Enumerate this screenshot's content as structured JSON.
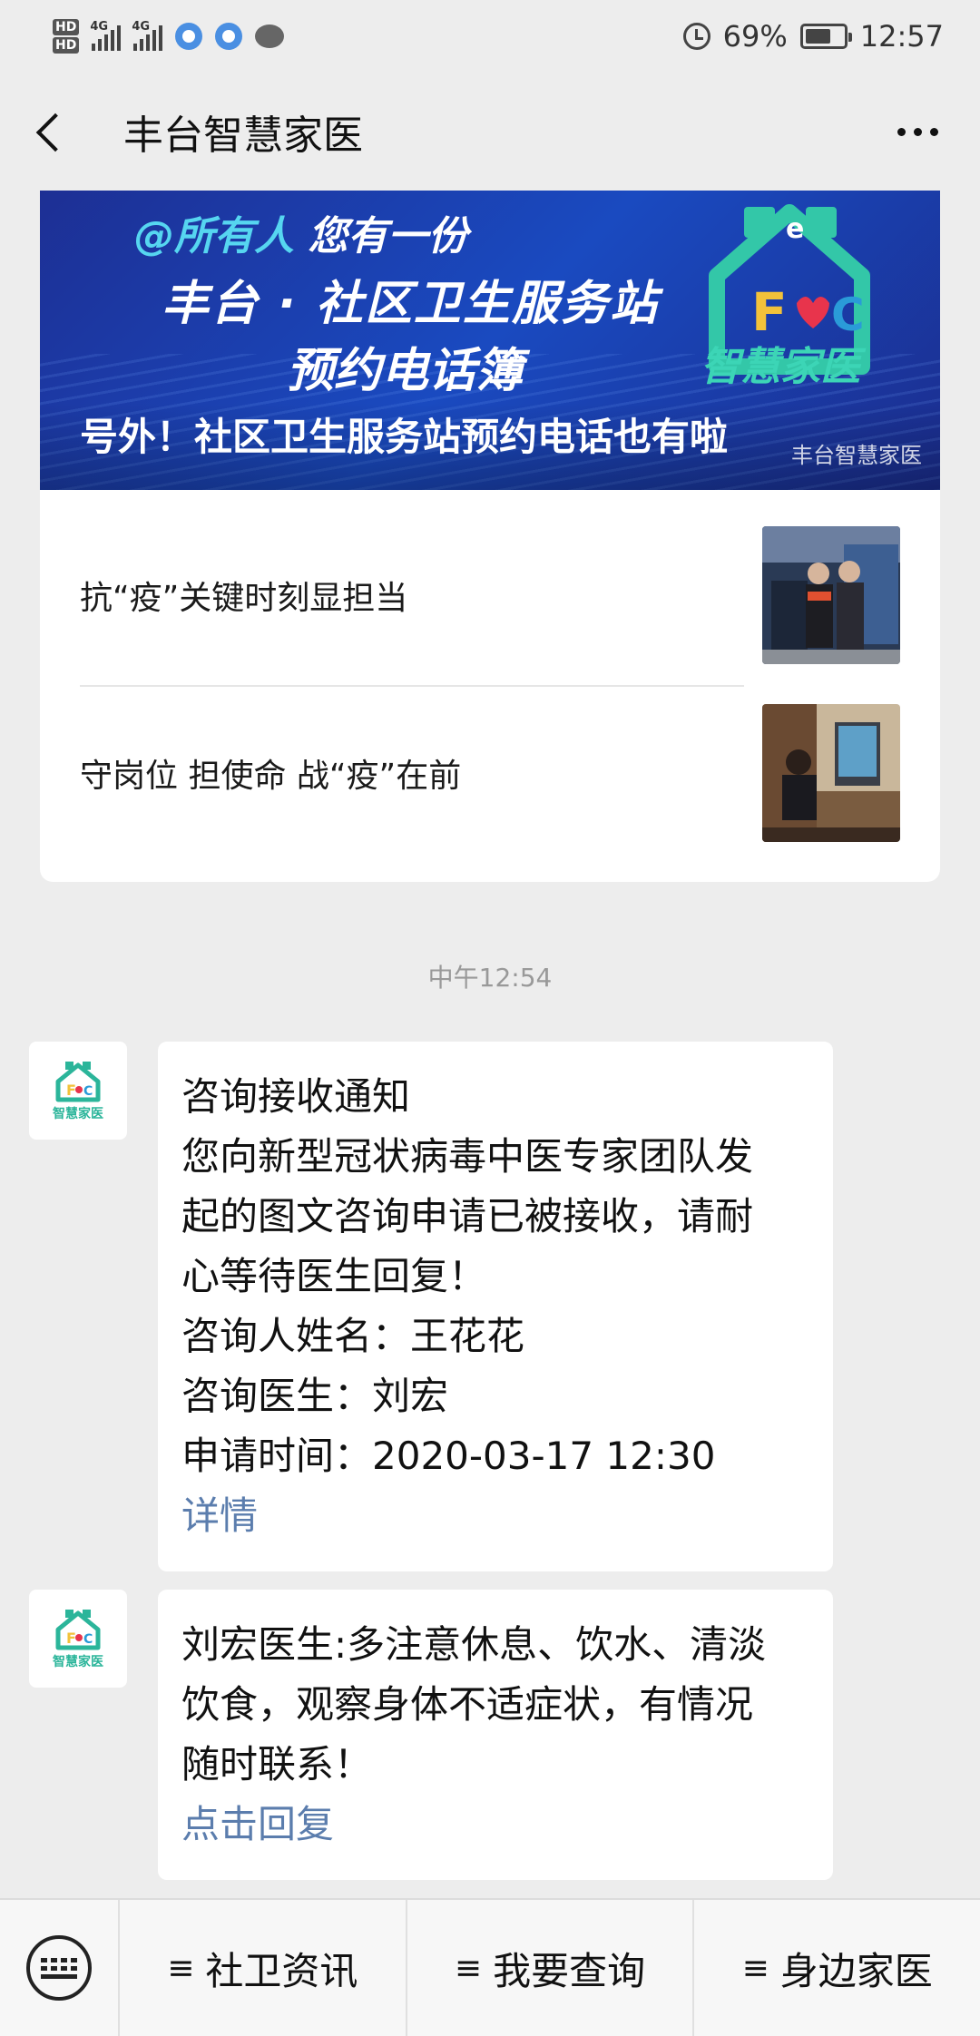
{
  "status_bar": {
    "hd1": "HD",
    "hd2": "HD",
    "net1": "4G",
    "net2": "4G",
    "battery_percent": "69%",
    "battery_level": 0.69,
    "time": "12:57"
  },
  "header": {
    "title": "丰台智慧家医"
  },
  "article": {
    "banner": {
      "line1_at": "@所有人",
      "line1_rest": " 您有一份",
      "line2": "丰台 · 社区卫生服务站",
      "line3": "预约电话簿",
      "caption": "号外！社区卫生服务站预约电话也有啦",
      "watermark": "丰台智慧家医",
      "logo_text": "智慧家医"
    },
    "items": [
      {
        "title": "抗“疫”关键时刻显担当"
      },
      {
        "title": "守岗位 担使命 战“疫”在前"
      }
    ]
  },
  "chat": {
    "timestamp": "中午12:54",
    "avatar_text": "智慧家医",
    "messages": [
      {
        "lines": [
          "咨询接收通知",
          "您向新型冠状病毒中医专家团队发",
          "起的图文咨询申请已被接收，请耐",
          "心等待医生回复！",
          "咨询人姓名：王花花",
          "咨询医生：刘宏",
          "申请时间：2020-03-17 12:30"
        ],
        "link": "详情"
      },
      {
        "lines": [
          "刘宏医生:多注意休息、饮水、清淡",
          "饮食，观察身体不适症状，有情况",
          "随时联系！"
        ],
        "link": "点击回复"
      }
    ]
  },
  "bottom_menu": {
    "items": [
      {
        "icon": "≡",
        "label": "社卫资讯"
      },
      {
        "icon": "≡",
        "label": "我要查询"
      },
      {
        "icon": "≡",
        "label": "身边家医"
      }
    ]
  },
  "colors": {
    "banner_blue": "#1a3fb0",
    "brand_teal": "#2bb59a",
    "link_blue": "#5b7dad",
    "background": "#ededed"
  }
}
